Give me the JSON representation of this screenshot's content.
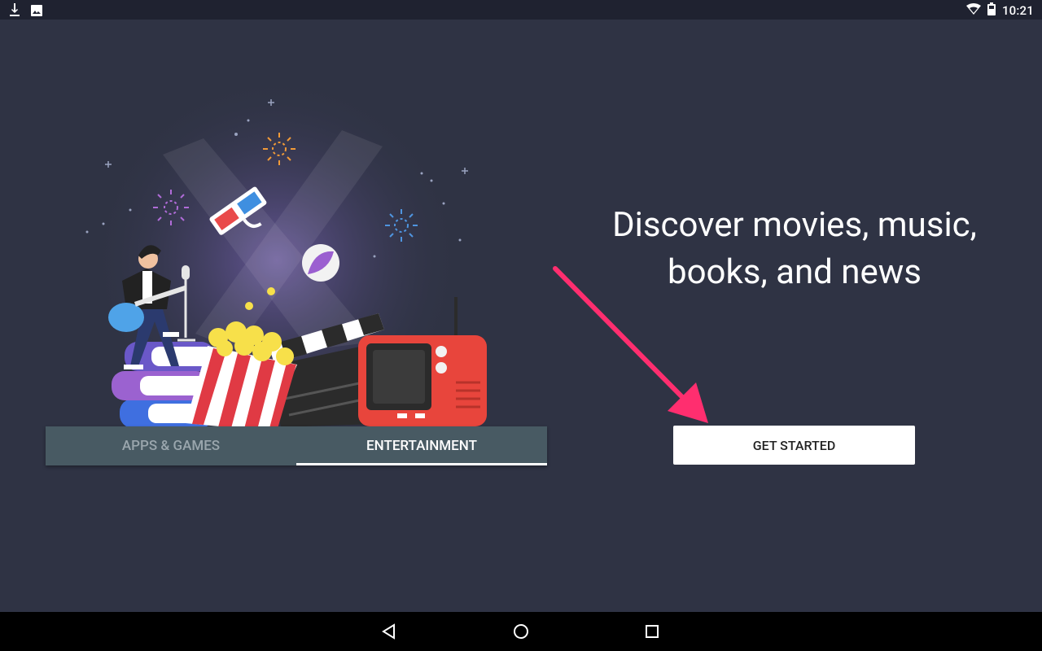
{
  "status_bar": {
    "time": "10:21",
    "left_icons": [
      "download-icon",
      "image-icon"
    ],
    "right_icons": [
      "wifi-icon",
      "battery-icon"
    ]
  },
  "tabs": [
    {
      "label": "APPS & GAMES",
      "active": false
    },
    {
      "label": "ENTERTAINMENT",
      "active": true
    }
  ],
  "headline": "Discover movies, music, books, and news",
  "headline_lines": [
    "Discover movies, music,",
    "books, and news"
  ],
  "cta": {
    "label": "GET STARTED"
  },
  "nav_bar": {
    "icons": [
      "back-icon",
      "home-icon",
      "recents-icon"
    ]
  },
  "colors": {
    "background": "#2f3344",
    "tab_bar": "#485a63",
    "annotation_arrow": "#ff2e6f"
  }
}
